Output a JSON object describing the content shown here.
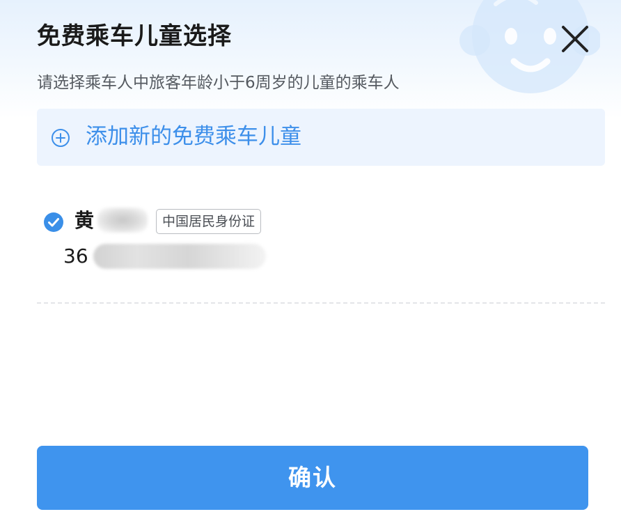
{
  "dialog": {
    "title": "免费乘车儿童选择",
    "subtitle": "请选择乘车人中旅客年龄小于6周岁的儿童的乘车人"
  },
  "add_child": {
    "label": "添加新的免费乘车儿童",
    "icon": "plus-circle-icon"
  },
  "passengers": [
    {
      "name_visible": "黄",
      "id_type": "中国居民身份证",
      "id_number_visible": "36",
      "selected": true
    }
  ],
  "confirm": {
    "label": "确认"
  },
  "colors": {
    "accent": "#3f94ee",
    "add_box_bg": "#edf4fe",
    "add_text": "#3d8fea",
    "check": "#3a8fe8"
  }
}
